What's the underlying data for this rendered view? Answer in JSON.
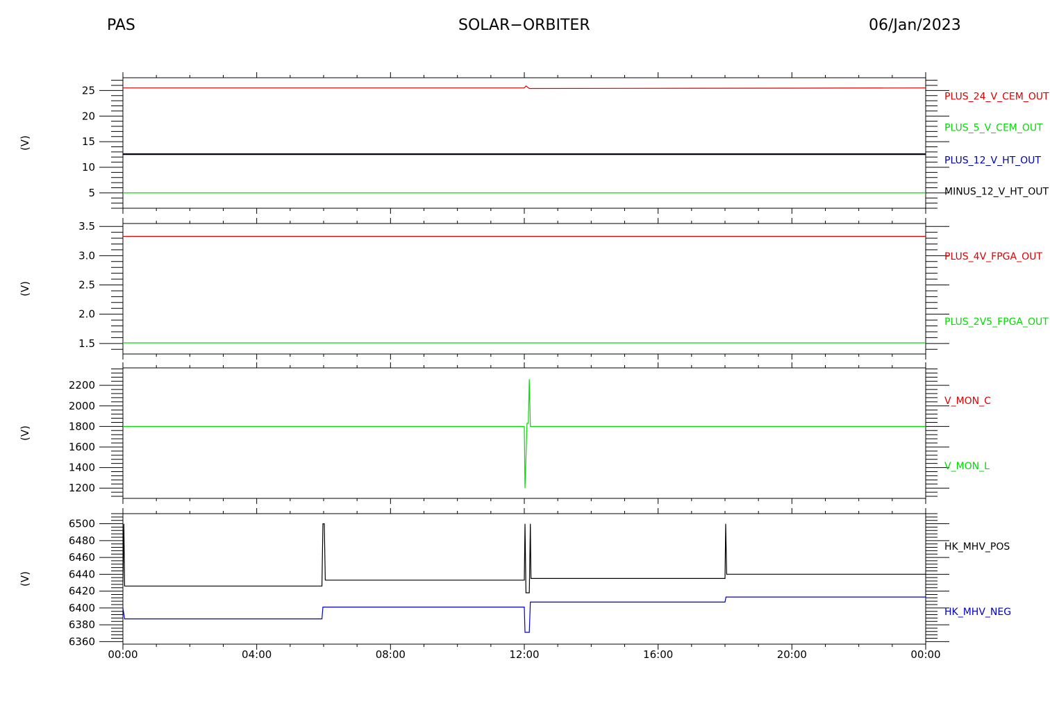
{
  "header": {
    "left": "PAS",
    "center": "SOLAR−ORBITER",
    "right": "06/Jan/2023"
  },
  "x_ticks": [
    "00:00",
    "04:00",
    "08:00",
    "12:00",
    "16:00",
    "20:00",
    "00:00"
  ],
  "chart_data": [
    {
      "type": "line",
      "ylabel": "(V)",
      "ylim": [
        2,
        27.5
      ],
      "yticks": [
        5,
        10,
        15,
        20,
        25
      ],
      "xlim": [
        0,
        24
      ],
      "series": [
        {
          "name": "PLUS_24_V_CEM_OUT",
          "color": "#dd0000",
          "x": [
            0,
            12.0,
            12.05,
            12.15,
            24
          ],
          "y": [
            25.5,
            25.5,
            25.9,
            25.4,
            25.5
          ]
        },
        {
          "name": "PLUS_5_V_CEM_OUT",
          "color": "#00dd00",
          "x": [
            0,
            24
          ],
          "y": [
            5.0,
            5.0
          ]
        },
        {
          "name": "PLUS_12_V_HT_OUT",
          "color": "#0000aa",
          "x": [
            0,
            24
          ],
          "y": [
            12.6,
            12.6
          ]
        },
        {
          "name": "MINUS_12_V_HT_OUT",
          "color": "#000000",
          "x": [
            0,
            24
          ],
          "y": [
            12.5,
            12.5
          ]
        }
      ]
    },
    {
      "type": "line",
      "ylabel": "(V)",
      "ylim": [
        1.32,
        3.55
      ],
      "yticks": [
        "1.5",
        "2.0",
        "2.5",
        "3.0",
        "3.5"
      ],
      "xlim": [
        0,
        24
      ],
      "series": [
        {
          "name": "PLUS_4V_FPGA_OUT",
          "color": "#dd0000",
          "x": [
            0,
            24
          ],
          "y": [
            3.33,
            3.33
          ]
        },
        {
          "name": "PLUS_2V5_FPGA_OUT",
          "color": "#00dd00",
          "x": [
            0,
            24
          ],
          "y": [
            1.51,
            1.51
          ]
        }
      ]
    },
    {
      "type": "line",
      "ylabel": "(V)",
      "ylim": [
        1100,
        2370
      ],
      "yticks": [
        1200,
        1400,
        1600,
        1800,
        2000,
        2200
      ],
      "xlim": [
        0,
        24
      ],
      "series": [
        {
          "name": "V_MON_C",
          "color": "#dd0000",
          "x": [],
          "y": []
        },
        {
          "name": "V_MON_L",
          "color": "#00dd00",
          "x": [
            0,
            12.0,
            12.02,
            12.08,
            12.12,
            12.15,
            12.18,
            24
          ],
          "y": [
            1800,
            1800,
            1200,
            1830,
            1830,
            2260,
            1800,
            1800
          ]
        }
      ]
    },
    {
      "type": "line",
      "ylabel": "(V)",
      "ylim": [
        6357,
        6512
      ],
      "yticks": [
        6360,
        6380,
        6400,
        6420,
        6440,
        6460,
        6480,
        6500
      ],
      "xlim": [
        0,
        24
      ],
      "series": [
        {
          "name": "HK_MHV_POS",
          "color": "#000000",
          "x": [
            0,
            0.03,
            0.05,
            0.08,
            5.95,
            5.98,
            6.02,
            6.05,
            12.0,
            12.02,
            12.05,
            12.1,
            12.15,
            12.18,
            12.2,
            18.0,
            18.02,
            18.05,
            24
          ],
          "y": [
            6430,
            6500,
            6426,
            6426,
            6426,
            6500,
            6500,
            6433,
            6433,
            6500,
            6418,
            6418,
            6418,
            6500,
            6435,
            6435,
            6500,
            6440,
            6440
          ]
        },
        {
          "name": "HK_MHV_NEG",
          "color": "#0000cc",
          "x": [
            0,
            0.05,
            0.08,
            5.95,
            5.98,
            12.0,
            12.02,
            12.15,
            12.18,
            18.0,
            18.03,
            24
          ],
          "y": [
            6400,
            6387,
            6387,
            6387,
            6401,
            6401,
            6371,
            6371,
            6407,
            6407,
            6413,
            6413
          ]
        }
      ]
    }
  ]
}
